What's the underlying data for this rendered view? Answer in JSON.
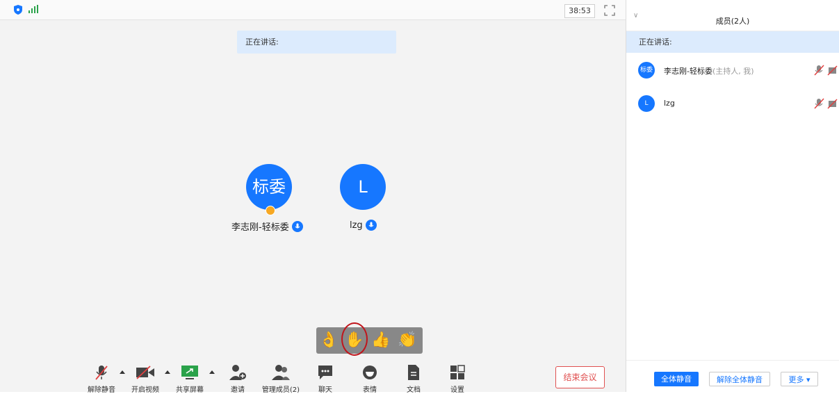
{
  "topbar": {
    "timer": "38:53",
    "icons": [
      "shield-icon",
      "signal-icon",
      "fullscreen-icon"
    ]
  },
  "stage": {
    "speaking_label": "正在讲话:",
    "participants": [
      {
        "avatar_text": "标委",
        "name": "李志刚-轻标委",
        "host": true
      },
      {
        "avatar_text": "L",
        "name": "lzg",
        "host": false
      }
    ],
    "reactions": [
      "👌",
      "✋",
      "👍",
      "👏"
    ]
  },
  "toolbar": {
    "unmute": "解除静音",
    "video": "开启视频",
    "share": "共享屏幕",
    "invite": "邀请",
    "members": "管理成员(2)",
    "chat": "聊天",
    "emoji": "表情",
    "docs": "文档",
    "settings": "设置",
    "end": "结束会议"
  },
  "panel": {
    "title": "成员(2人)",
    "speaking_label": "正在讲话:",
    "members": [
      {
        "avatar_text": "标委",
        "name": "李志刚-轻标委",
        "role": "(主持人, 我)"
      },
      {
        "avatar_text": "L",
        "name": "lzg",
        "role": ""
      }
    ],
    "buttons": {
      "mute_all": "全体静音",
      "unmute_all": "解除全体静音",
      "more": "更多 ▾"
    }
  },
  "colors": {
    "accent": "#1677ff",
    "banner": "#dcebfd",
    "end_red": "#e05050",
    "share_green": "#2aa24a"
  }
}
